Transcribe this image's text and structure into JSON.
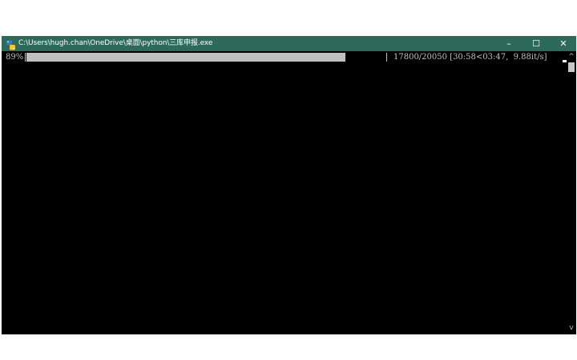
{
  "window": {
    "title": "C:\\Users\\hugh.chan\\OneDrive\\桌面\\python\\三库申报.exe",
    "icon": "python-icon",
    "controls": {
      "minimize": "–",
      "maximize": "☐",
      "close": "✕"
    }
  },
  "console": {
    "percent_label": "89%",
    "progress_fraction": 0.888,
    "stats": "17800/20050 [30:58<03:47,  9.88it/s]"
  },
  "scrollbar": {
    "up_arrow": "^",
    "down_arrow": "v"
  },
  "colors": {
    "titlebar": "#2d6a5b",
    "console_bg": "#000000",
    "console_fg": "#c0c0c0"
  }
}
